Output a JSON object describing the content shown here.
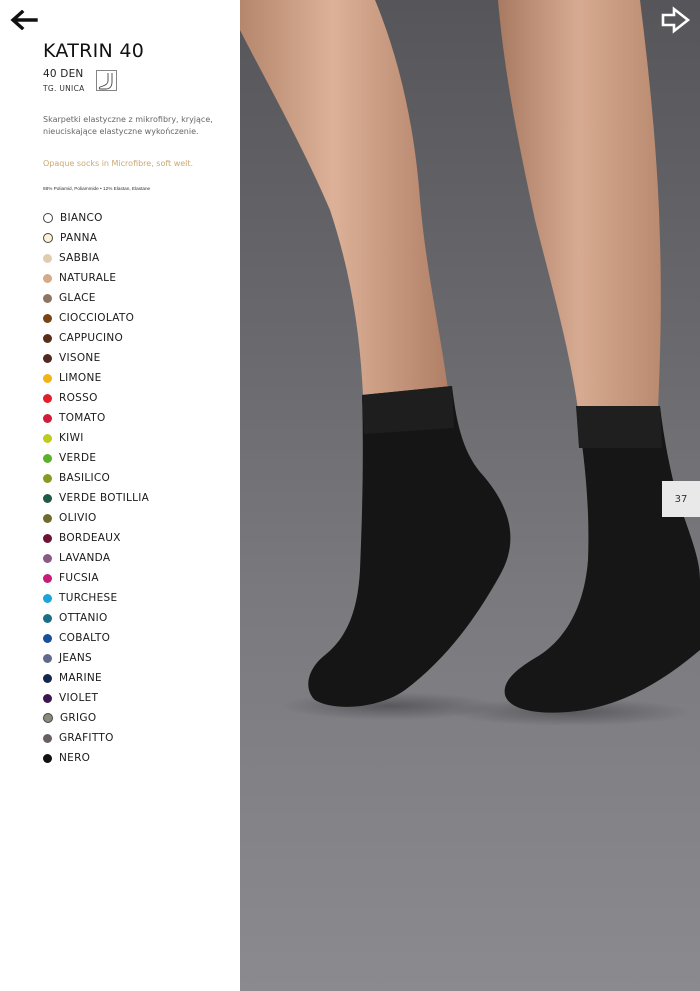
{
  "nav": {
    "back_icon": "arrow-left-icon",
    "next_icon": "arrow-right-outline-icon"
  },
  "product": {
    "title": "KATRIN 40",
    "den": "40 DEN",
    "size": "TG. UNICA",
    "sock_icon": "sock-outline-icon",
    "description_pl": "Skarpetki elastyczne z mikrofibry, kryjące, nieuciskające elastyczne wykończenie.",
    "description_en": "Opaque socks in Microfibre, soft welt.",
    "composition": "88% Poliamid, Poliammide • 12% Elastan, Elastane"
  },
  "colors": [
    {
      "name": "BIANCO",
      "hex": "#ffffff",
      "outlined": true
    },
    {
      "name": "PANNA",
      "hex": "#fbf3d6",
      "outlined": true
    },
    {
      "name": "SABBIA",
      "hex": "#e2ccb0",
      "outlined": false
    },
    {
      "name": "NATURALE",
      "hex": "#d6a988",
      "outlined": false
    },
    {
      "name": "GLACE",
      "hex": "#8e7463",
      "outlined": false
    },
    {
      "name": "CIOCCIOLATO",
      "hex": "#7a4316",
      "outlined": false
    },
    {
      "name": "CAPPUCINO",
      "hex": "#5a2c1a",
      "outlined": false
    },
    {
      "name": "VISONE",
      "hex": "#4f2a20",
      "outlined": false
    },
    {
      "name": "LIMONE",
      "hex": "#f0b418",
      "outlined": false
    },
    {
      "name": "ROSSO",
      "hex": "#e01f2a",
      "outlined": false
    },
    {
      "name": "TOMATO",
      "hex": "#cf1b3c",
      "outlined": false
    },
    {
      "name": "KIWI",
      "hex": "#bccb1e",
      "outlined": false
    },
    {
      "name": "VERDE",
      "hex": "#5cb02d",
      "outlined": false
    },
    {
      "name": "BASILICO",
      "hex": "#8a9a1e",
      "outlined": false
    },
    {
      "name": "VERDE BOTILLIA",
      "hex": "#1e5a44",
      "outlined": false
    },
    {
      "name": "OLIVIO",
      "hex": "#6f6a2e",
      "outlined": false
    },
    {
      "name": "BORDEAUX",
      "hex": "#6e1238",
      "outlined": false
    },
    {
      "name": "LAVANDA",
      "hex": "#8a5a86",
      "outlined": false
    },
    {
      "name": "FUCSIA",
      "hex": "#c81a77",
      "outlined": false
    },
    {
      "name": "TURCHESE",
      "hex": "#1aa5d8",
      "outlined": false
    },
    {
      "name": "OTTANIO",
      "hex": "#1a6e86",
      "outlined": false
    },
    {
      "name": "COBALTO",
      "hex": "#1a4f9a",
      "outlined": false
    },
    {
      "name": "JEANS",
      "hex": "#5f6a8e",
      "outlined": false
    },
    {
      "name": "MARINE",
      "hex": "#14264e",
      "outlined": false
    },
    {
      "name": "VIOLET",
      "hex": "#3d1650",
      "outlined": false
    },
    {
      "name": "GRIGO",
      "hex": "#8a8a7a",
      "outlined": true
    },
    {
      "name": "GRAFITTO",
      "hex": "#666066",
      "outlined": false
    },
    {
      "name": "NERO",
      "hex": "#111111",
      "outlined": false
    }
  ],
  "page": {
    "number": "37"
  },
  "photo": {
    "subject": "legs-wearing-black-socks-photo"
  }
}
